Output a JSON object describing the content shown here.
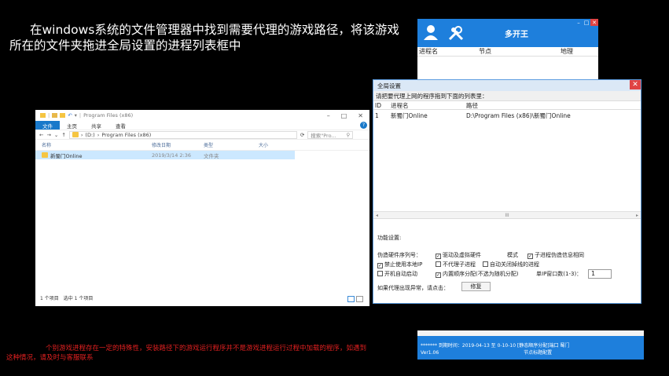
{
  "instruction": "在windows系统的文件管理器中找到需要代理的游戏路径，将该游戏所在的文件夹拖进全局设置的进程列表框中",
  "bottom_note": "个别游戏进程存在一定的特殊性，安装路径下的游戏运行程序并不是游戏进程运行过程中加载的程序，如遇到这种情况，请及时与客服联系",
  "explorer": {
    "title": "Program Files (x86)",
    "window_controls": [
      "–",
      "□",
      "✕"
    ],
    "ribbon_tabs": [
      "文件",
      "主页",
      "共享",
      "查看"
    ],
    "address": [
      "(D:)",
      "Program Files (x86)"
    ],
    "search_placeholder": "搜索\"Pro...",
    "columns": [
      "名称",
      "修改日期",
      "类型",
      "大小"
    ],
    "rows": [
      {
        "name": "新蜀门Online",
        "date": "2019/3/14 2:36",
        "type": "文件夹",
        "size": ""
      }
    ],
    "status_items": "1 个项目",
    "status_selected": "选中 1 个项目"
  },
  "multi_open": {
    "title": "多开王",
    "columns": [
      "进程名",
      "节点",
      "地理"
    ],
    "status_line1": "******* 到期时间：2019-04-13 至 0-10-10 [静态顺序分配]端口 蜀门",
    "status_line2_left": "Ver1.06",
    "status_line2_right": "节点标题配置"
  },
  "global_settings": {
    "title": "全局设置",
    "hint": "请把要代理上网的程序拖到下面的列表里：",
    "columns": [
      "ID",
      "进程名",
      "路径"
    ],
    "rows": [
      {
        "id": "1",
        "name": "新蜀门Online",
        "path": "D:\\Program Files (x86)\\新蜀门Online"
      }
    ],
    "function_label": "功能设置:",
    "hw_label": "伪造硬件序列号：",
    "opt_driver": "驱动及虚拟硬件",
    "mode_label": "模式",
    "opt_child_same": "子进程伪造信息相同",
    "opt_no_local_ip": "禁止使用本地IP",
    "opt_no_child": "不代理子进程",
    "opt_auto_close": "自动关闭掉线的进程",
    "opt_autostart": "开机自动启动",
    "opt_seq_alloc": "内置顺序分配(不选为随机分配)",
    "single_ip_label": "单IP窗口数(1-3)：",
    "single_ip_value": "1",
    "error_label": "如果代理出现异常，请点击：",
    "fix_button": "修复"
  }
}
